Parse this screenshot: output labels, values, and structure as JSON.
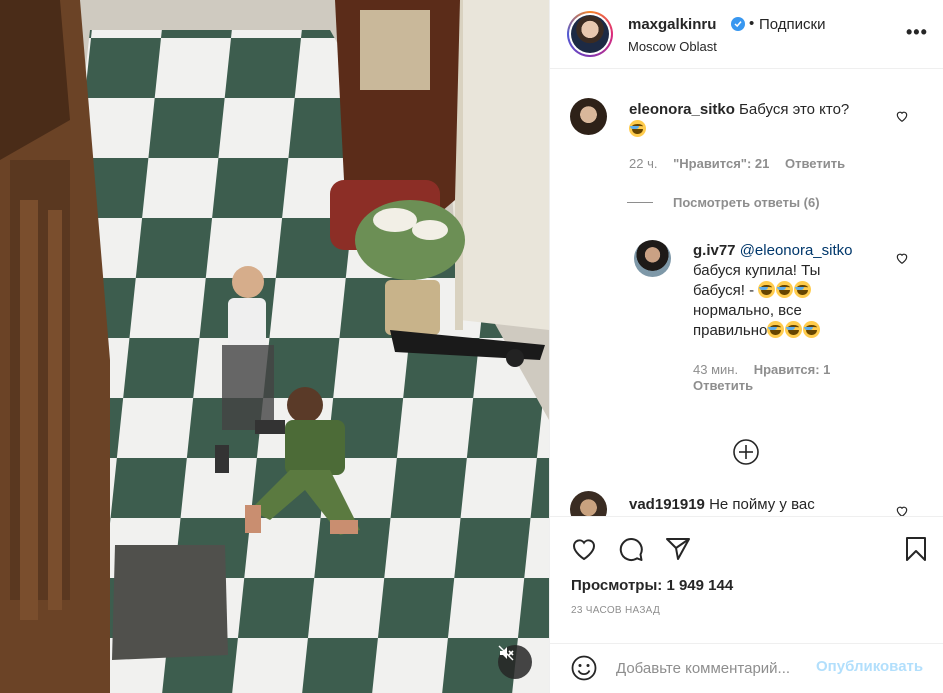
{
  "post": {
    "username": "maxgalkinru",
    "verified": true,
    "separator": "•",
    "follow_state": "Подписки",
    "location": "Moscow Oblast",
    "more": "•••"
  },
  "comments": [
    {
      "username": "eleonora_sitko",
      "text": "Бабуся это кто?",
      "emoji": [
        "joy"
      ],
      "time": "22 ч.",
      "likes": "\"Нравится\": 21",
      "reply": "Ответить",
      "view_replies": "Посмотреть ответы (6)"
    },
    {
      "username": "g.iv77",
      "mention": "@eleonora_sitko",
      "line1": "бабуся купила! Ты",
      "line2": "бабуся! -",
      "line3": "нормально, все",
      "line4": "правильно",
      "emoji": [
        "joy",
        "joy",
        "joy"
      ],
      "time": "43 мин.",
      "likes": "Нравится: 1",
      "reply": "Ответить"
    },
    {
      "username": "vad191919",
      "text": "Не пойму у вас"
    }
  ],
  "actions": {
    "views_label": "Просмотры:",
    "views_count": "1 949 144",
    "timestamp": "23 ЧАСОВ НАЗАД"
  },
  "add_comment": {
    "placeholder": "Добавьте комментарий...",
    "post_label": "Опубликовать"
  },
  "colors": {
    "link": "#00376b",
    "muted": "#8e8e8e",
    "post_disabled": "#b2dffc",
    "verified": "#3897f0"
  },
  "icons": [
    "mute-icon",
    "heart-icon",
    "comment-icon",
    "share-icon",
    "bookmark-icon",
    "emoji-icon",
    "plus-circle-icon",
    "verified-icon",
    "more-icon"
  ]
}
